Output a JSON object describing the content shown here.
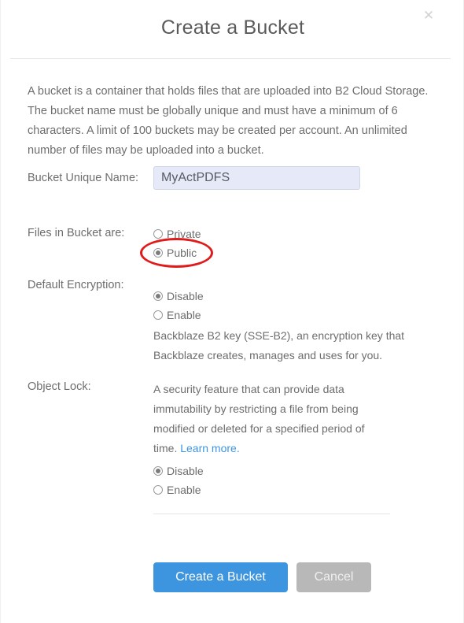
{
  "dialog": {
    "title": "Create a Bucket",
    "close_icon": "close-icon",
    "intro": "A bucket is a container that holds files that are uploaded into B2 Cloud Storage. The bucket name must be globally unique and must have a minimum of 6 characters. A limit of 100 buckets may be created per account. An unlimited number of files may be uploaded into a bucket."
  },
  "bucket_name": {
    "label": "Bucket Unique Name:",
    "value": "MyActPDFS",
    "placeholder": ""
  },
  "files_visibility": {
    "label": "Files in Bucket are:",
    "options": [
      {
        "label": "Private",
        "selected": false
      },
      {
        "label": "Public",
        "selected": true
      }
    ],
    "highlight_color": "#e01b1b"
  },
  "encryption": {
    "label": "Default Encryption:",
    "options": [
      {
        "label": "Disable",
        "selected": true
      },
      {
        "label": "Enable",
        "selected": false
      }
    ],
    "description": "Backblaze B2 key (SSE-B2), an encryption key that Backblaze creates, manages and uses for you."
  },
  "object_lock": {
    "label": "Object Lock:",
    "description": "A security feature that can provide data immutability by restricting a file from being modified or deleted for a specified period of time. ",
    "link_text": "Learn more.",
    "options": [
      {
        "label": "Disable",
        "selected": true
      },
      {
        "label": "Enable",
        "selected": false
      }
    ]
  },
  "actions": {
    "submit_label": "Create a Bucket",
    "cancel_label": "Cancel",
    "submit_color": "#3d95e0",
    "cancel_color": "#b8b8b8"
  }
}
